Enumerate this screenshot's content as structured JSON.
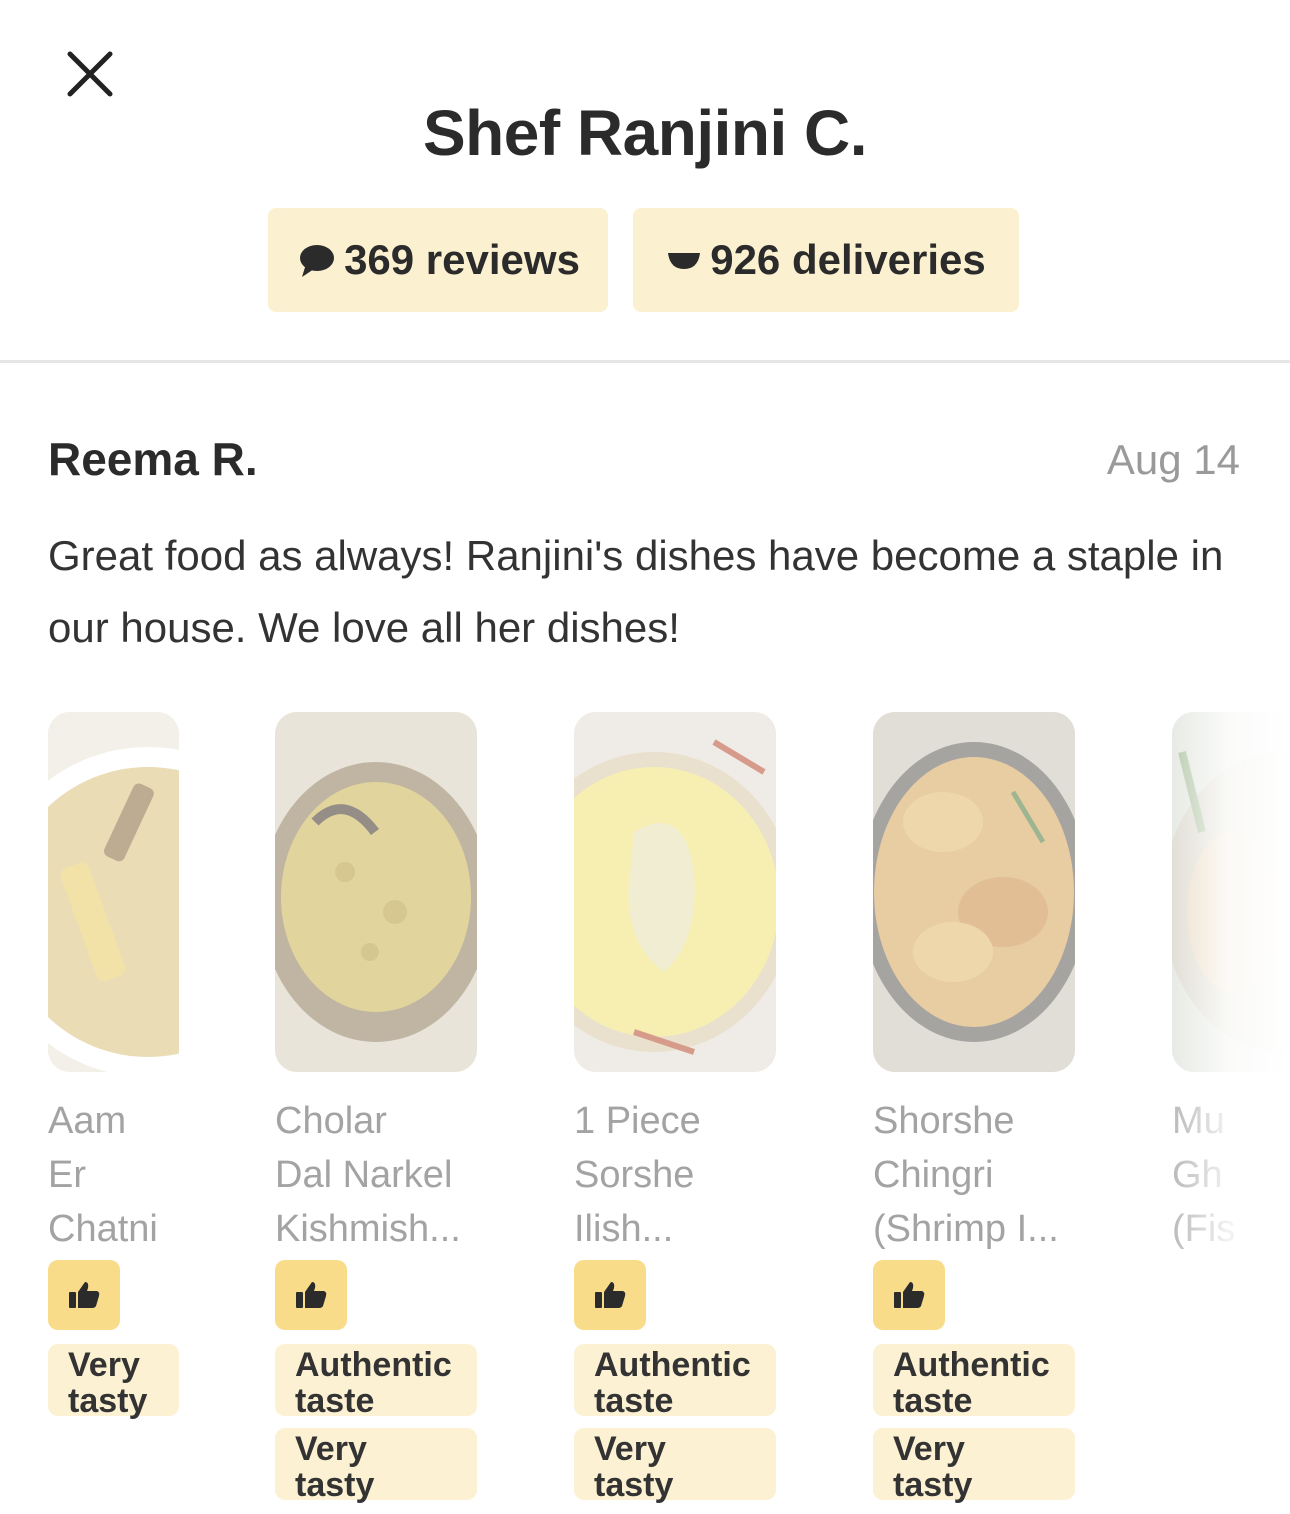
{
  "header": {
    "title": "Shef Ranjini C.",
    "reviews_label": "369 reviews",
    "deliveries_label": "926 deliveries"
  },
  "review": {
    "reviewer": "Reema R.",
    "date": "Aug 14",
    "text": "Great food as always! Ranjini's dishes have become a staple in our house. We love all her dishes!"
  },
  "dishes": [
    {
      "name": "Aam\nEr\nChatni",
      "tags": [
        "Very\ntasty"
      ]
    },
    {
      "name": "Cholar\nDal Narkel\nKishmish...",
      "tags": [
        "Authentic\ntaste",
        "Very\ntasty"
      ]
    },
    {
      "name": "1 Piece\nSorshe\nIlish...",
      "tags": [
        "Authentic\ntaste",
        "Very\ntasty"
      ]
    },
    {
      "name": "Shorshe\nChingri\n(Shrimp I...",
      "tags": [
        "Authentic\ntaste",
        "Very\ntasty"
      ]
    },
    {
      "name": "Mu\nGh\n(Fis",
      "tags": []
    }
  ],
  "icons": {
    "close": "close-icon",
    "reviews": "speech-bubble-icon",
    "deliveries": "bowl-icon",
    "thumb": "thumbs-up-icon"
  },
  "colors": {
    "badge_bg": "#fbf1d0",
    "thumb_bg": "#f8dc8a",
    "tag_bg": "#fcf1d3"
  }
}
